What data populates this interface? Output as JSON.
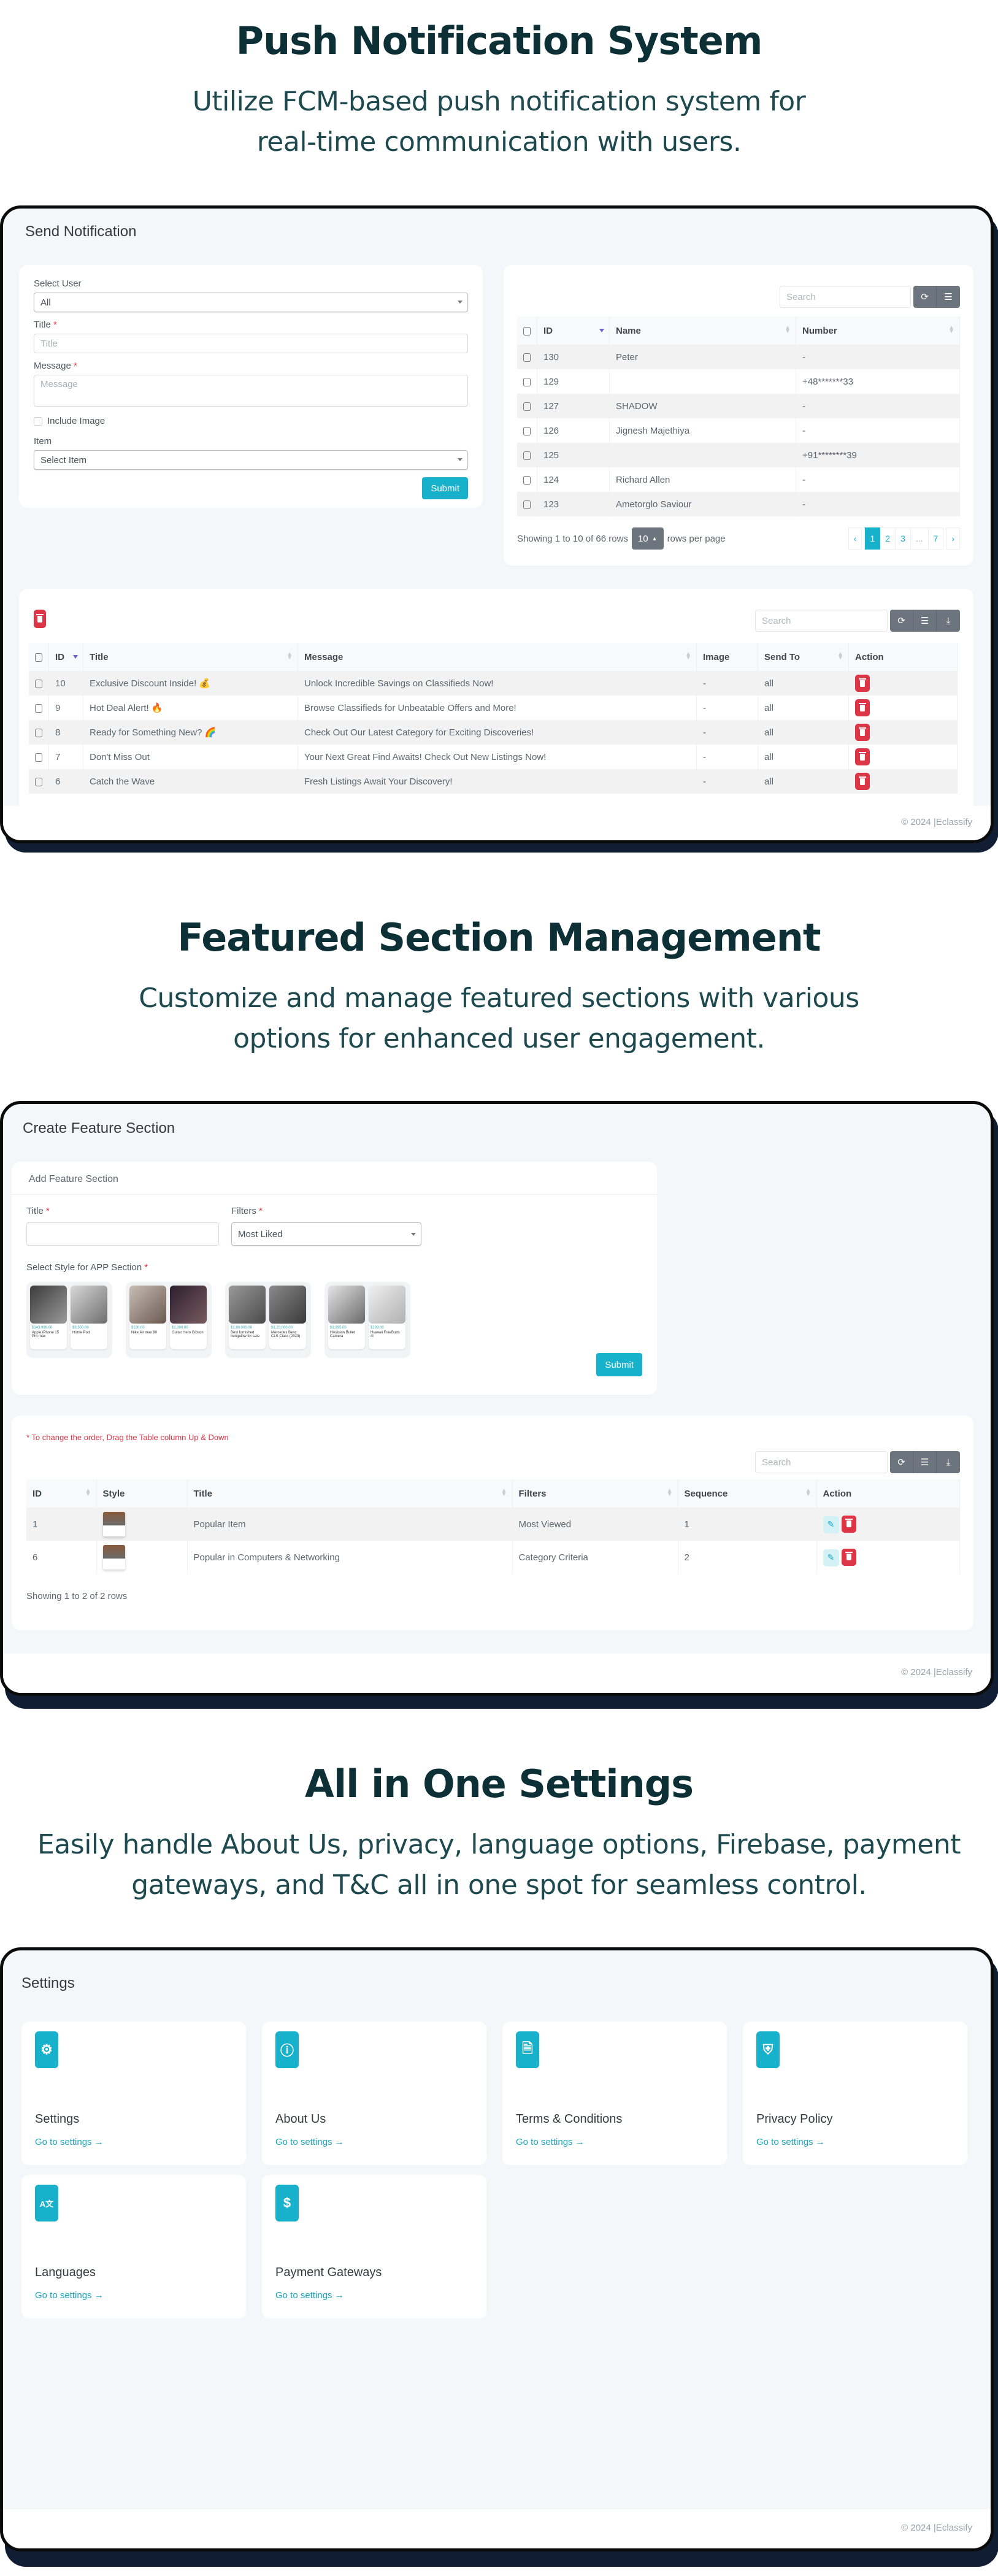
{
  "sections": {
    "push": {
      "heading": "Push Notification System",
      "subtitle_line1": "Utilize FCM-based push notification system for",
      "subtitle_line2": "real-time communication with users."
    },
    "featured": {
      "heading": "Featured Section Management",
      "subtitle_line1": "Customize and manage featured sections with various",
      "subtitle_line2": "options for enhanced user engagement."
    },
    "settings": {
      "heading": "All in One Settings",
      "subtitle_line1": "Easily handle About Us, privacy, language options, Firebase, payment",
      "subtitle_line2": "gateways, and T&C all in one spot for seamless control."
    }
  },
  "copyright": "© 2024 |Eclassify",
  "send_notification": {
    "page_title": "Send Notification",
    "form": {
      "select_user_label": "Select User",
      "select_user_value": "All",
      "title_label": "Title",
      "title_placeholder": "Title",
      "message_label": "Message",
      "message_placeholder": "Message",
      "include_image_label": "Include Image",
      "include_image_checked": false,
      "item_label": "Item",
      "item_value": "Select Item",
      "submit_label": "Submit",
      "required_mark": "*"
    },
    "users_table": {
      "search_placeholder": "Search",
      "columns": [
        "ID",
        "Name",
        "Number"
      ],
      "rows": [
        {
          "id": "130",
          "name": "Peter",
          "number": "-"
        },
        {
          "id": "129",
          "name": "",
          "number": "+48*******33"
        },
        {
          "id": "127",
          "name": "SHADOW",
          "number": "-"
        },
        {
          "id": "126",
          "name": "Jignesh Majethiya",
          "number": "-"
        },
        {
          "id": "125",
          "name": "",
          "number": "+91********39"
        },
        {
          "id": "124",
          "name": "Richard Allen",
          "number": "-"
        },
        {
          "id": "123",
          "name": "Ametorglo Saviour",
          "number": "-"
        }
      ],
      "showing_text": "Showing 1 to 10 of 66 rows",
      "page_size": "10",
      "rows_per_page_text": "rows per page",
      "pagination": {
        "prev": "‹",
        "pages": [
          "1",
          "2",
          "3",
          "...",
          "7"
        ],
        "active": "1",
        "next": "›"
      }
    },
    "notifications_table": {
      "search_placeholder": "Search",
      "columns": [
        "ID",
        "Title",
        "Message",
        "Image",
        "Send To",
        "Action"
      ],
      "rows": [
        {
          "id": "10",
          "title": "Exclusive Discount Inside! 💰",
          "message": "Unlock Incredible Savings on Classifieds Now!",
          "image": "-",
          "send_to": "all"
        },
        {
          "id": "9",
          "title": "Hot Deal Alert! 🔥",
          "message": "Browse Classifieds for Unbeatable Offers and More!",
          "image": "-",
          "send_to": "all"
        },
        {
          "id": "8",
          "title": "Ready for Something New? 🌈",
          "message": "Check Out Our Latest Category for Exciting Discoveries!",
          "image": "-",
          "send_to": "all"
        },
        {
          "id": "7",
          "title": "Don't Miss Out",
          "message": "Your Next Great Find Awaits! Check Out New Listings Now!",
          "image": "-",
          "send_to": "all"
        },
        {
          "id": "6",
          "title": "Catch the Wave",
          "message": "Fresh Listings Await Your Discovery!",
          "image": "-",
          "send_to": "all"
        }
      ]
    }
  },
  "feature_section": {
    "page_title": "Create Feature Section",
    "card_title": "Add Feature Section",
    "title_label": "Title",
    "filters_label": "Filters",
    "filters_value": "Most Liked",
    "style_label": "Select Style for APP Section",
    "styles": [
      {
        "cards": [
          {
            "price": "$143,999.00",
            "name": "Apple iPhone 15 Pro max"
          },
          {
            "price": "$9,500.00",
            "name": "Home Pod"
          }
        ]
      },
      {
        "cards": [
          {
            "price": "$130.00",
            "name": "Nike Air max 90"
          },
          {
            "price": "$1,200.00",
            "name": "Guitar Hero Gibson"
          }
        ]
      },
      {
        "cards": [
          {
            "price": "$1,90,000.00",
            "name": "Best furnished bungalow for sale"
          },
          {
            "price": "$1,20,000.00",
            "name": "Mercedes Benz CLS Class (2023)"
          }
        ]
      },
      {
        "cards": [
          {
            "price": "$1,995.00",
            "name": "Hikvision Bullet Camera"
          },
          {
            "price": "$199.00",
            "name": "Huawei FreeBuds 4i"
          }
        ]
      }
    ],
    "submit_label": "Submit",
    "drag_hint": "* To change the order, Drag the Table column Up & Down",
    "table": {
      "search_placeholder": "Search",
      "columns": [
        "ID",
        "Style",
        "Title",
        "Filters",
        "Sequence",
        "Action"
      ],
      "rows": [
        {
          "id": "1",
          "title": "Popular Item",
          "filters": "Most Viewed",
          "sequence": "1"
        },
        {
          "id": "6",
          "title": "Popular in Computers & Networking",
          "filters": "Category Criteria",
          "sequence": "2"
        }
      ],
      "showing_text": "Showing 1 to 2 of 2 rows"
    }
  },
  "settings_page": {
    "page_title": "Settings",
    "link_label": "Go to settings →",
    "cards": [
      {
        "title": "Settings",
        "icon": "gears-icon"
      },
      {
        "title": "About Us",
        "icon": "info-icon"
      },
      {
        "title": "Terms & Conditions",
        "icon": "contract-icon"
      },
      {
        "title": "Privacy Policy",
        "icon": "shield-icon"
      },
      {
        "title": "Languages",
        "icon": "language-icon"
      },
      {
        "title": "Payment Gateways",
        "icon": "dollar-icon"
      }
    ]
  },
  "colors": {
    "accent": "#17b1cc",
    "danger": "#dc3545",
    "heading": "#0c3035",
    "frame_shadow": "#111d33"
  }
}
